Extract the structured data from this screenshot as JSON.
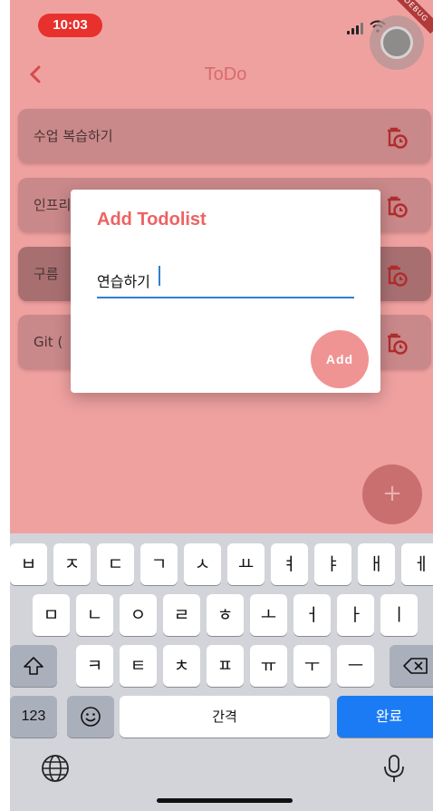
{
  "status": {
    "time": "10:03",
    "debug_label": "DEBUG"
  },
  "appbar": {
    "title": "ToDo",
    "back_icon": "chevron-left-icon"
  },
  "todos": [
    {
      "text": "수업 복습하기",
      "icon": "delete-schedule-icon"
    },
    {
      "text": "인프리",
      "icon": "delete-schedule-icon"
    },
    {
      "text": "구름",
      "icon": "delete-schedule-icon"
    },
    {
      "text": "Git (",
      "icon": "delete-schedule-icon"
    }
  ],
  "fab": {
    "label": "+"
  },
  "dialog": {
    "title": "Add Todolist",
    "input_value": "연습하기",
    "add_label": "Add"
  },
  "keyboard": {
    "row1": [
      "ㅂ",
      "ㅈ",
      "ㄷ",
      "ㄱ",
      "ㅅ",
      "ㅛ",
      "ㅕ",
      "ㅑ",
      "ㅐ",
      "ㅔ"
    ],
    "row2": [
      "ㅁ",
      "ㄴ",
      "ㅇ",
      "ㄹ",
      "ㅎ",
      "ㅗ",
      "ㅓ",
      "ㅏ",
      "ㅣ"
    ],
    "row3": [
      "ㅋ",
      "ㅌ",
      "ㅊ",
      "ㅍ",
      "ㅠ",
      "ㅜ",
      "ㅡ"
    ],
    "numbers_label": "123",
    "space_label": "간격",
    "done_label": "완료"
  },
  "colors": {
    "accent": "#ef6262",
    "overlay": "#efa1a0",
    "add_button": "#f09393",
    "done_key": "#1a7bf5"
  }
}
